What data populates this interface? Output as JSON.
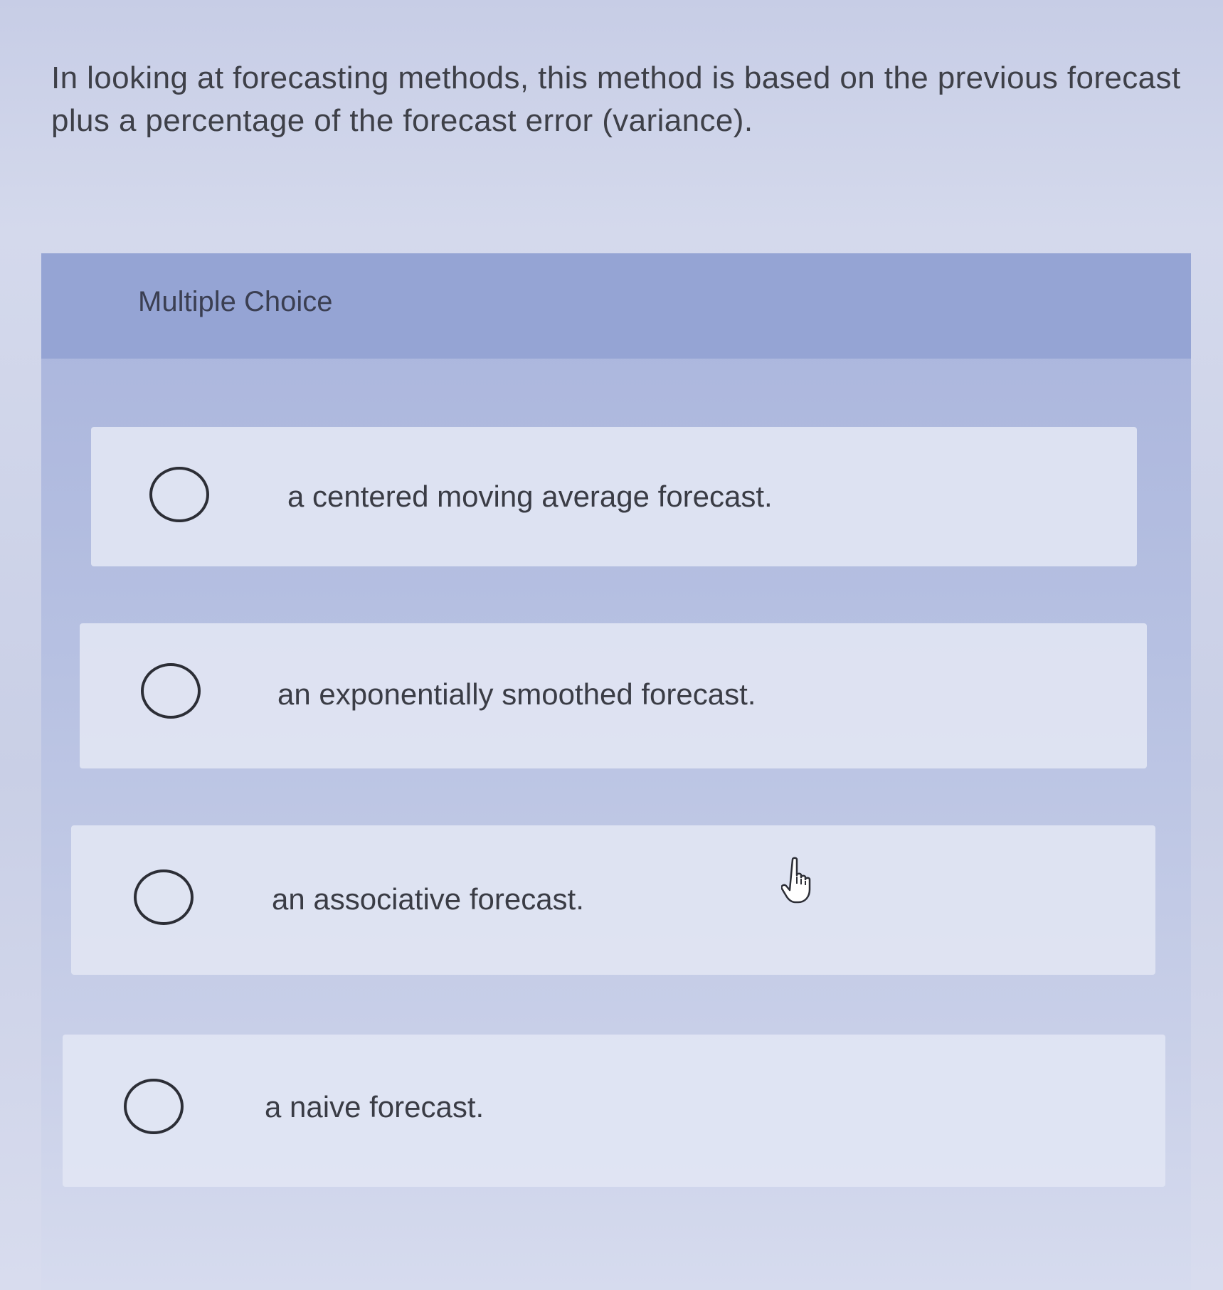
{
  "question": {
    "text": "In looking at forecasting methods, this method is based on the previous forecast plus a percentage of the forecast error (variance)."
  },
  "multiple_choice": {
    "title": "Multiple Choice",
    "options": [
      {
        "label": "a centered moving average forecast.",
        "selected": false
      },
      {
        "label": "an exponentially smoothed forecast.",
        "selected": false
      },
      {
        "label": "an associative forecast.",
        "selected": false
      },
      {
        "label": "a naive forecast.",
        "selected": false
      }
    ]
  },
  "cursor": {
    "icon": "hand-pointer-icon"
  }
}
